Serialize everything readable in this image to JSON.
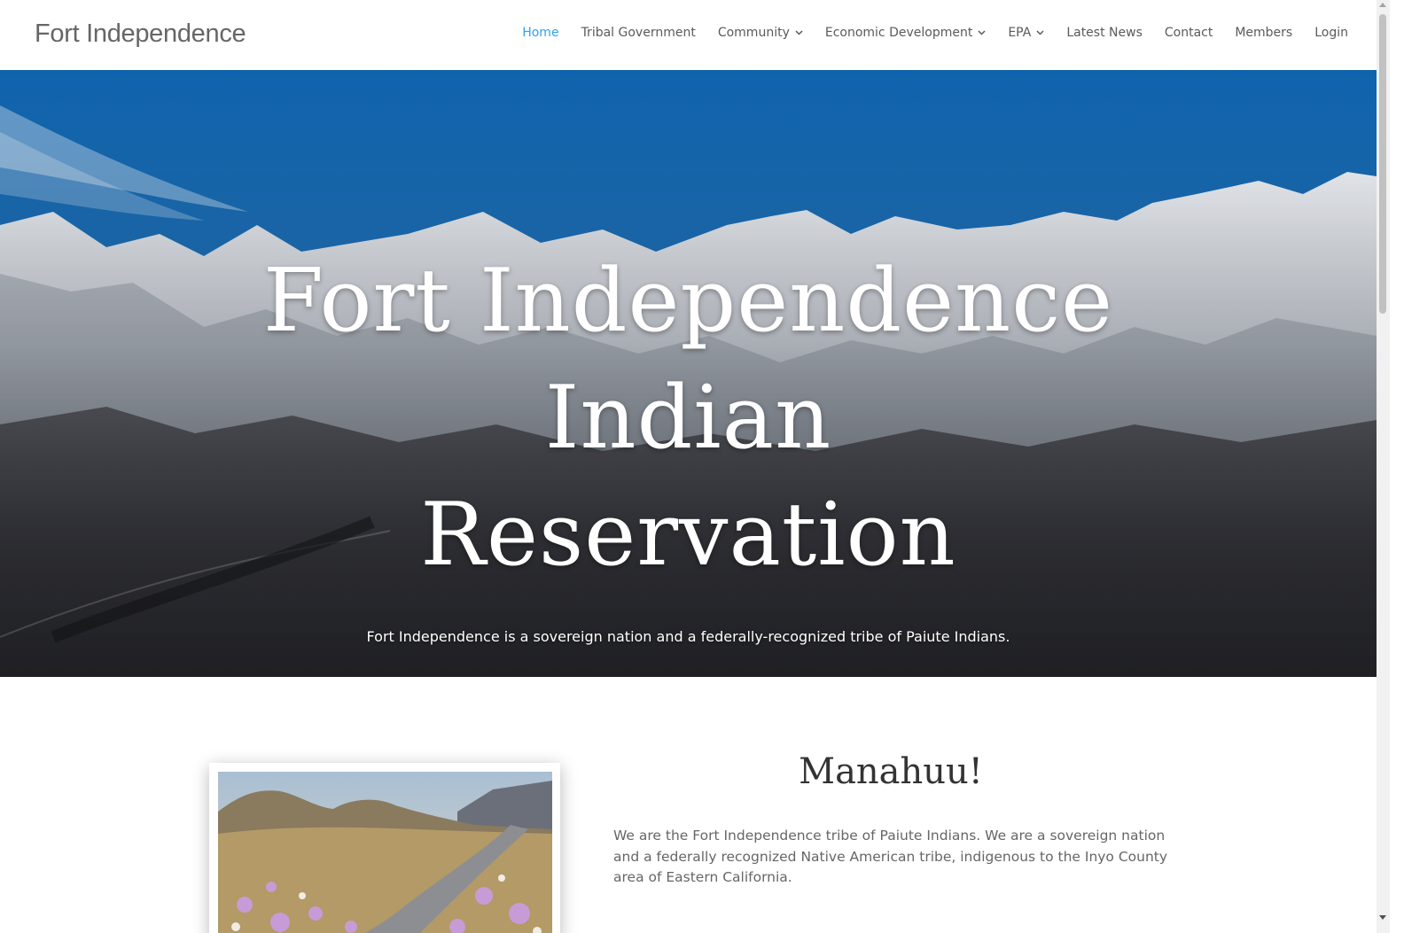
{
  "site": {
    "logo_text": "Fort Independence"
  },
  "nav": {
    "items": [
      {
        "label": "Home",
        "active": true,
        "dropdown": false
      },
      {
        "label": "Tribal Government",
        "active": false,
        "dropdown": false
      },
      {
        "label": "Community",
        "active": false,
        "dropdown": true
      },
      {
        "label": "Economic Development",
        "active": false,
        "dropdown": true
      },
      {
        "label": "EPA",
        "active": false,
        "dropdown": true
      },
      {
        "label": "Latest News",
        "active": false,
        "dropdown": false
      },
      {
        "label": "Contact",
        "active": false,
        "dropdown": false
      },
      {
        "label": "Members",
        "active": false,
        "dropdown": false
      },
      {
        "label": "Login",
        "active": false,
        "dropdown": false
      }
    ],
    "dropdown_icon": "chevron-down-icon"
  },
  "hero": {
    "title_lines": [
      "Fort Independence",
      "Indian",
      "Reservation"
    ],
    "subtitle": "Fort Independence is a sovereign nation and a federally-recognized tribe of Paiute Indians."
  },
  "intro": {
    "heading": "Manahuu!",
    "body": "We are the Fort Independence tribe of Paiute Indians. We are a sovereign nation and a federally recognized Native American tribe, indigenous to the Inyo County area of Eastern California."
  },
  "colors": {
    "accent": "#2ea3f2",
    "nav_text": "#5a5a5a",
    "body_text": "#666666",
    "heading_text": "#333333"
  }
}
